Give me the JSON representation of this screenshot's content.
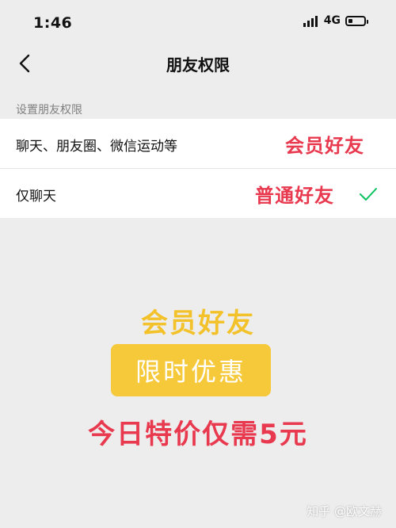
{
  "status_bar": {
    "time": "1:46",
    "network": "4G",
    "battery_level": 0.25
  },
  "nav": {
    "title": "朋友权限",
    "back_icon": "chevron-left-icon"
  },
  "section": {
    "label": "设置朋友权限"
  },
  "options": [
    {
      "label": "聊天、朋友圈、微信运动等",
      "tag": "会员好友",
      "selected": false
    },
    {
      "label": "仅聊天",
      "tag": "普通好友",
      "selected": true
    }
  ],
  "promo": {
    "title": "会员好友",
    "badge": "限时优惠",
    "price_text": "今日特价仅需5元"
  },
  "watermark": "知乎 @欧文赫",
  "colors": {
    "accent_red": "#e8394f",
    "accent_yellow": "#f3c22a",
    "check_green": "#07c160",
    "background": "#ededed"
  }
}
